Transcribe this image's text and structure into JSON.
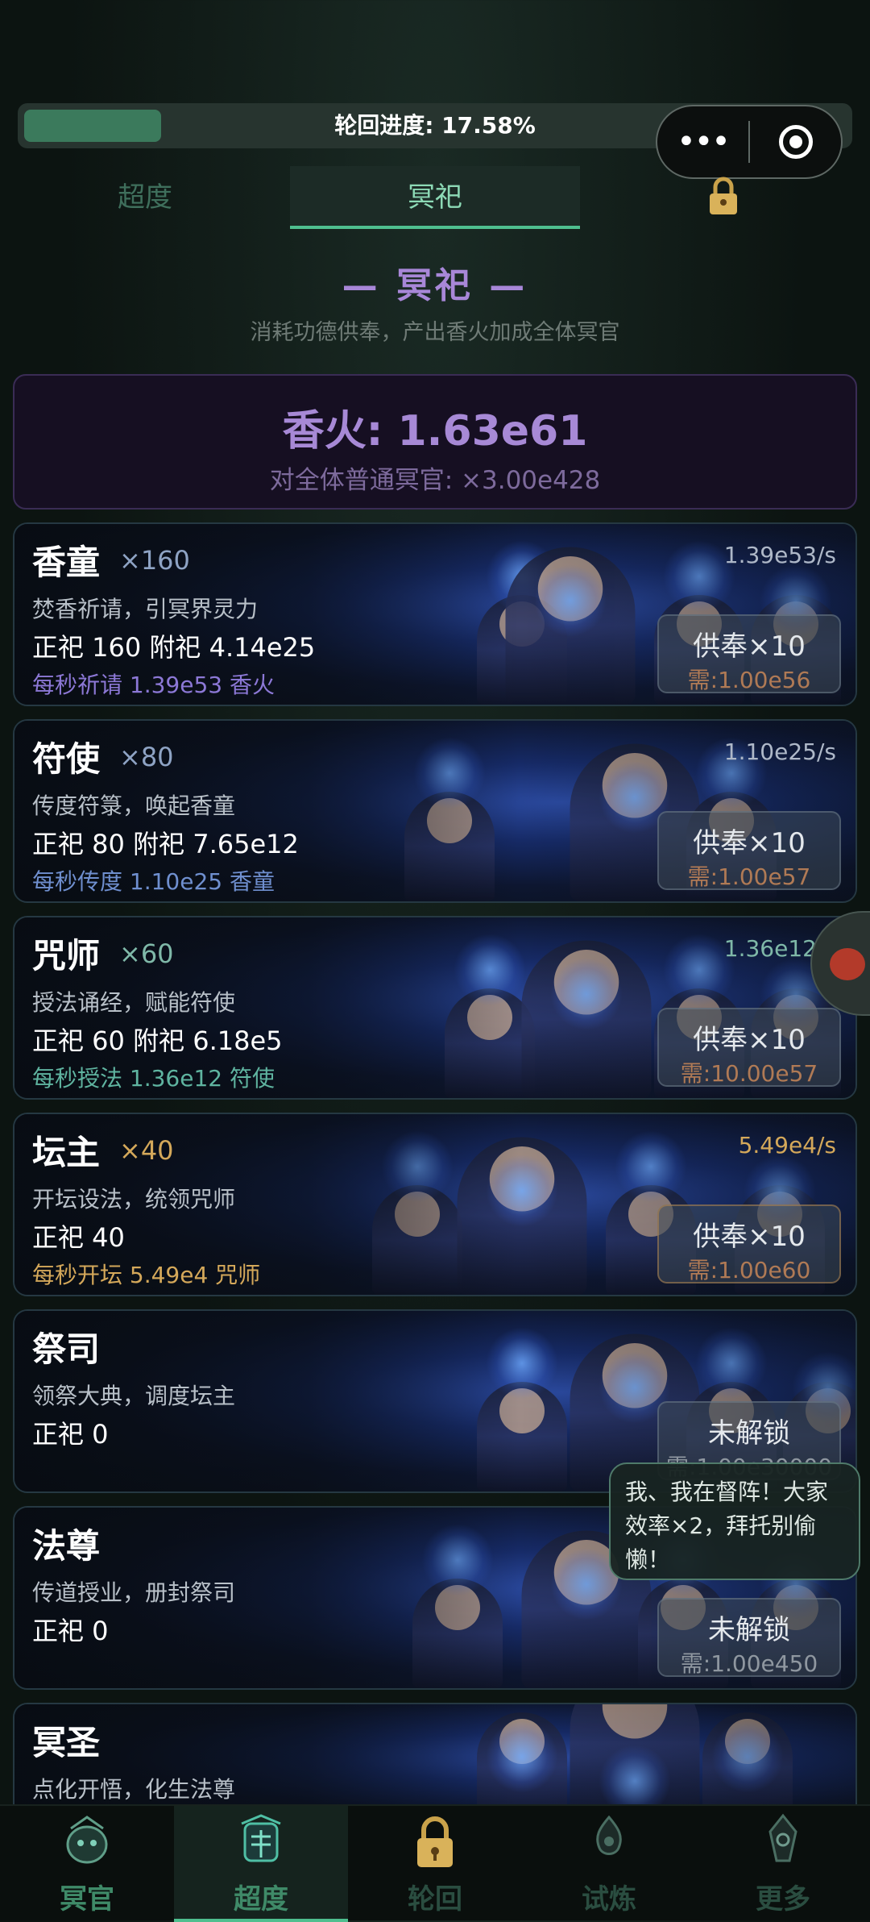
{
  "progress": {
    "label": "轮回进度: 17.58%",
    "fraction": 0.1758
  },
  "capsule": {
    "more_icon": "more-dots-icon",
    "close_icon": "record-target-icon"
  },
  "tabs": [
    {
      "label": "超度",
      "active": false
    },
    {
      "label": "冥祀",
      "active": true
    },
    {
      "label": "",
      "locked": true
    }
  ],
  "section": {
    "title": "— 冥祀 —",
    "desc": "消耗功德供奉，产出香火加成全体冥官"
  },
  "incense": {
    "title": "香火: 1.63e61",
    "bonus": "对全体普通冥官: ×3.00e428"
  },
  "cards": [
    {
      "name": "香童",
      "mult": "×160",
      "rate": "1.39e53/s",
      "desc": "焚香祈请，引冥界灵力",
      "stats": "正祀 160  附祀 4.14e25",
      "prod": "每秒祈请 1.39e53 香火",
      "btn": "供奉×10",
      "cost": "需:1.00e56",
      "prod_color": "#8c78d6",
      "mult_color": "#8ea3c4"
    },
    {
      "name": "符使",
      "mult": "×80",
      "rate": "1.10e25/s",
      "desc": "传度符箓，唤起香童",
      "stats": "正祀 80  附祀 7.65e12",
      "prod": "每秒传度 1.10e25 香童",
      "btn": "供奉×10",
      "cost": "需:1.00e57",
      "prod_color": "#6f8fcf",
      "mult_color": "#8ea3c4"
    },
    {
      "name": "咒师",
      "mult": "×60",
      "rate": "1.36e12/s",
      "desc": "授法诵经，赋能符使",
      "stats": "正祀 60  附祀 6.18e5",
      "prod": "每秒授法 1.36e12 符使",
      "btn": "供奉×10",
      "cost": "需:10.00e57",
      "prod_color": "#5fb4a0",
      "mult_color": "#7fb8a8"
    },
    {
      "name": "坛主",
      "mult": "×40",
      "rate": "5.49e4/s",
      "desc": "开坛设法，统领咒师",
      "stats": "正祀 40",
      "prod": "每秒开坛 5.49e4 咒师",
      "btn": "供奉×10",
      "cost": "需:1.00e60",
      "prod_color": "#d4a85a",
      "mult_color": "#d4a85a"
    },
    {
      "name": "祭司",
      "mult": "",
      "rate": "",
      "desc": "领祭大典，调度坛主",
      "stats": "正祀 0",
      "prod": "",
      "btn": "未解锁",
      "cost": "需:1.00e30000",
      "prod_color": "#8c78d6",
      "mult_color": "#8ea3c4"
    },
    {
      "name": "法尊",
      "mult": "",
      "rate": "",
      "desc": "传道授业，册封祭司",
      "stats": "正祀 0",
      "prod": "",
      "btn": "未解锁",
      "cost": "需:1.00e450",
      "prod_color": "#8c78d6",
      "mult_color": "#8ea3c4"
    },
    {
      "name": "冥圣",
      "mult": "",
      "rate": "",
      "desc": "点化开悟，化生法尊",
      "stats": "",
      "prod": "",
      "btn": "",
      "cost": "",
      "prod_color": "#8c78d6",
      "mult_color": "#8ea3c4"
    }
  ],
  "bubble": {
    "text": "我、我在督阵！大家效率×2，拜托别偷懒！"
  },
  "nav": [
    {
      "label": "冥官",
      "icon": "underworld-official-icon",
      "active": false
    },
    {
      "label": "超度",
      "icon": "salvation-icon",
      "active": true
    },
    {
      "label": "轮回",
      "icon": "lock-icon",
      "active": false,
      "locked": true
    },
    {
      "label": "试炼",
      "icon": "trial-icon",
      "active": false
    },
    {
      "label": "更多",
      "icon": "more-icon",
      "active": false
    }
  ]
}
